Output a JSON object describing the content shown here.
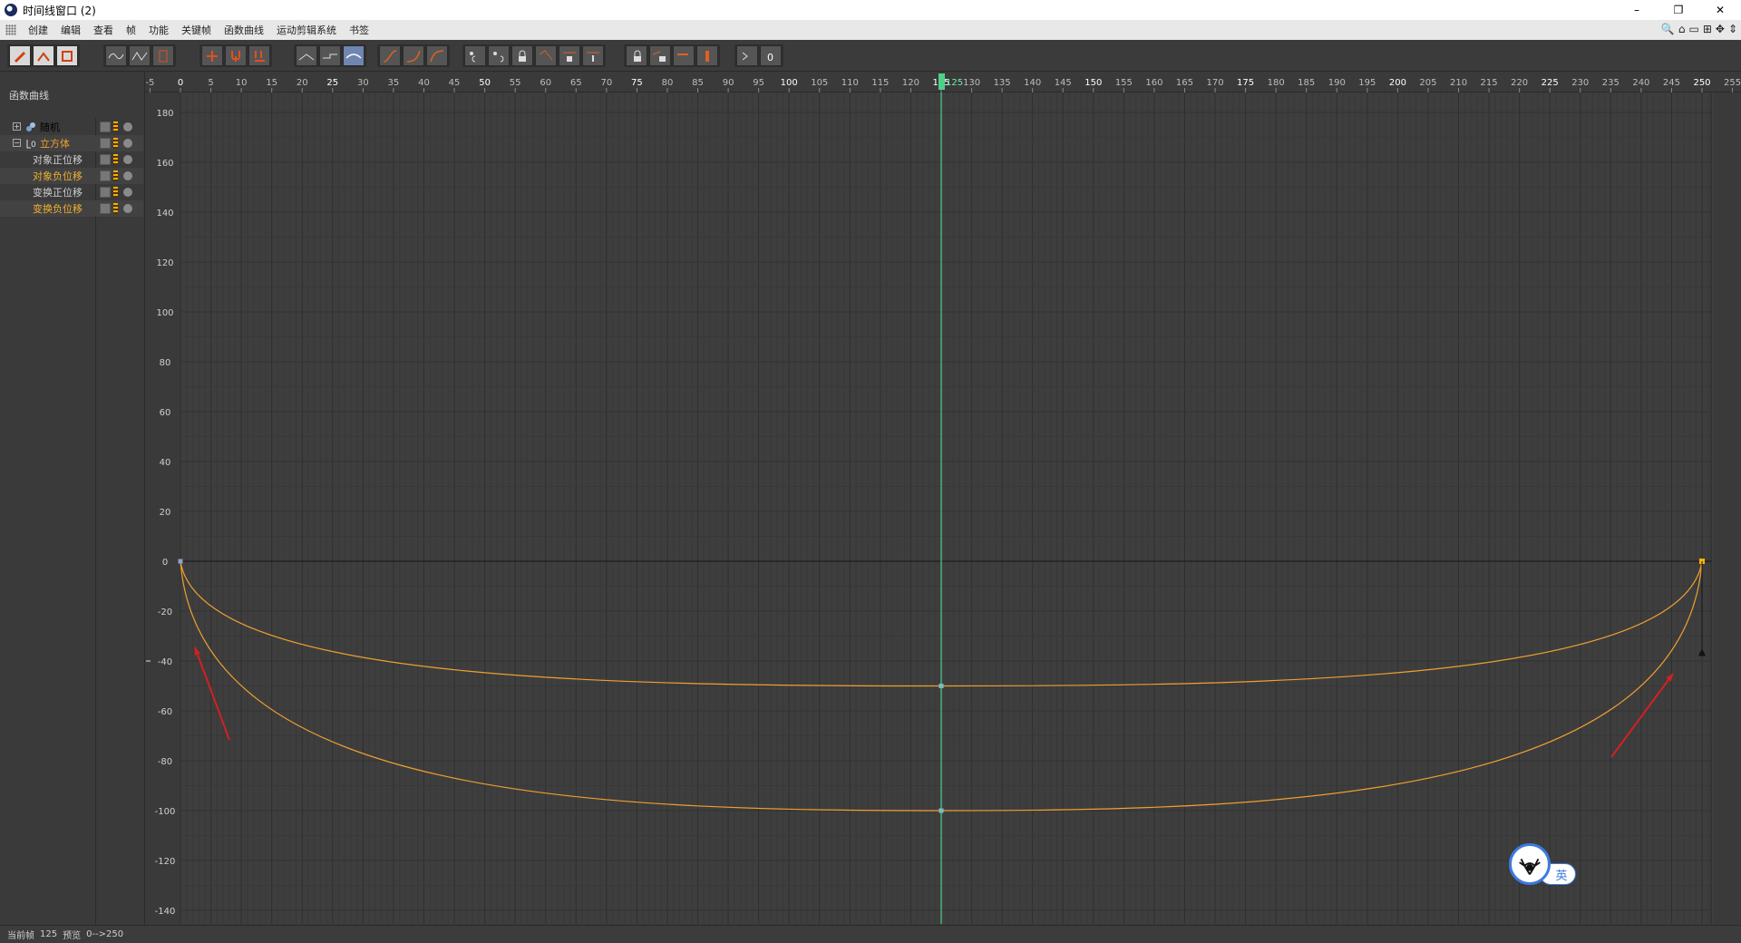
{
  "window": {
    "title": "时间线窗口 (2)",
    "buttons": [
      "–",
      "❐",
      "✕"
    ]
  },
  "menu": {
    "items": [
      "创建",
      "编辑",
      "查看",
      "帧",
      "功能",
      "关键帧",
      "函数曲线",
      "运动剪辑系统",
      "书签"
    ],
    "right_tools": [
      "🔍",
      "⌂",
      "▭",
      "⊞",
      "✥",
      "⇕"
    ]
  },
  "left_panel": {
    "title": "函数曲线",
    "tree": [
      {
        "label": "随机",
        "expand": "+",
        "level": 0,
        "color": "#d0d0d0"
      },
      {
        "label": "立方体",
        "expand": "−",
        "level": 0,
        "color": "#f0a030"
      },
      {
        "label": "对象正位移",
        "level": 1,
        "color": "#d0d0d0"
      },
      {
        "label": "对象负位移",
        "level": 1,
        "color": "#f0b030"
      },
      {
        "label": "变换正位移",
        "level": 1,
        "color": "#d0d0d0"
      },
      {
        "label": "变换负位移",
        "level": 1,
        "color": "#f0b030"
      }
    ]
  },
  "graph": {
    "x_ticks": [
      "-5",
      "0",
      "5",
      "10",
      "15",
      "20",
      "25",
      "30",
      "35",
      "40",
      "45",
      "50",
      "55",
      "60",
      "65",
      "70",
      "75",
      "80",
      "85",
      "90",
      "95",
      "100",
      "105",
      "110",
      "115",
      "120",
      "125",
      "130",
      "135",
      "140",
      "145",
      "150",
      "155",
      "160",
      "165",
      "170",
      "175",
      "180",
      "185",
      "190",
      "195",
      "200",
      "205",
      "210",
      "215",
      "220",
      "225",
      "230",
      "235",
      "240",
      "245",
      "250",
      "255"
    ],
    "y_ticks": [
      "180",
      "160",
      "140",
      "120",
      "100",
      "80",
      "60",
      "40",
      "20",
      "0",
      "-20",
      "-40",
      "-60",
      "-80",
      "-100",
      "-120",
      "-140"
    ],
    "current_frame_label": "125",
    "colors": {
      "background": "#3e3e3e",
      "grid": "#353535",
      "curve": "#f0a030",
      "playhead": "#4ed08a",
      "arrow": "#d42020"
    }
  },
  "chart_data": {
    "type": "line",
    "title": "",
    "xlabel": "",
    "ylabel": "",
    "xlim": [
      -5,
      255
    ],
    "ylim": [
      -150,
      190
    ],
    "grid": true,
    "current_frame": 125,
    "series": [
      {
        "name": "",
        "x": [
          0,
          125,
          250
        ],
        "y": [
          0,
          -50,
          0
        ]
      },
      {
        "name": "",
        "x": [
          0,
          125,
          250
        ],
        "y": [
          0,
          -100,
          0
        ]
      }
    ]
  },
  "status": {
    "current_frame_label": "当前帧",
    "current_frame_value": "125",
    "preview_label": "预览",
    "preview_range": "0-->250"
  },
  "ime": {
    "mode": "英"
  }
}
